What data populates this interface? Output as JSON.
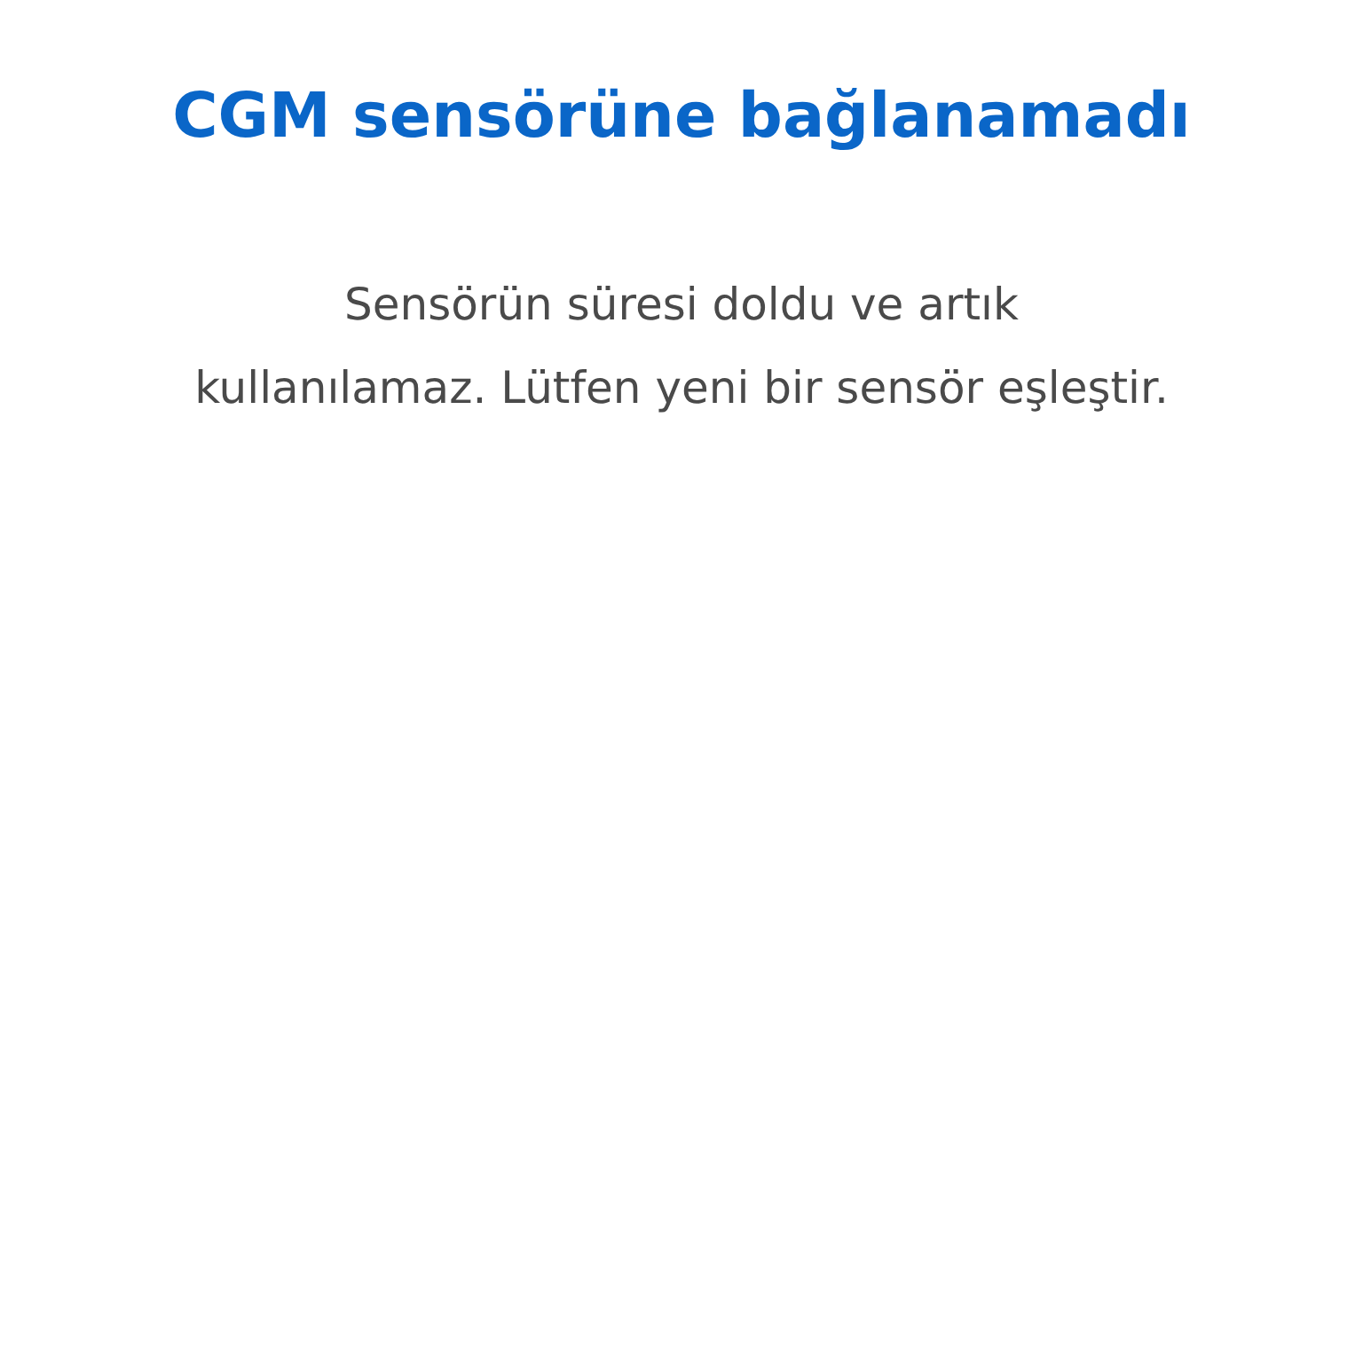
{
  "title": "CGM sensörüne bağlanamadı",
  "message": "Sensörün süresi doldu ve artık\nkullanılamaz. Lütfen yeni bir sensör eşleştir."
}
